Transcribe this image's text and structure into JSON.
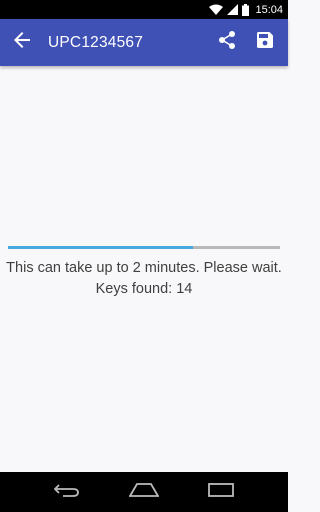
{
  "status_bar": {
    "time": "15:04",
    "icons": [
      "wifi-icon",
      "cell-signal-icon",
      "battery-icon"
    ]
  },
  "app_bar": {
    "title": "UPC1234567",
    "back_icon": "arrow-back-icon",
    "actions": [
      "share-icon",
      "save-icon"
    ],
    "background": "#3f51b5"
  },
  "content": {
    "progress": 0.68,
    "progress_color": "#45a9e0",
    "message": "This can take up to 2 minutes. Please wait. Keys found: 14"
  },
  "nav_bar": {
    "buttons": [
      "back-icon",
      "home-icon",
      "recents-icon"
    ]
  }
}
